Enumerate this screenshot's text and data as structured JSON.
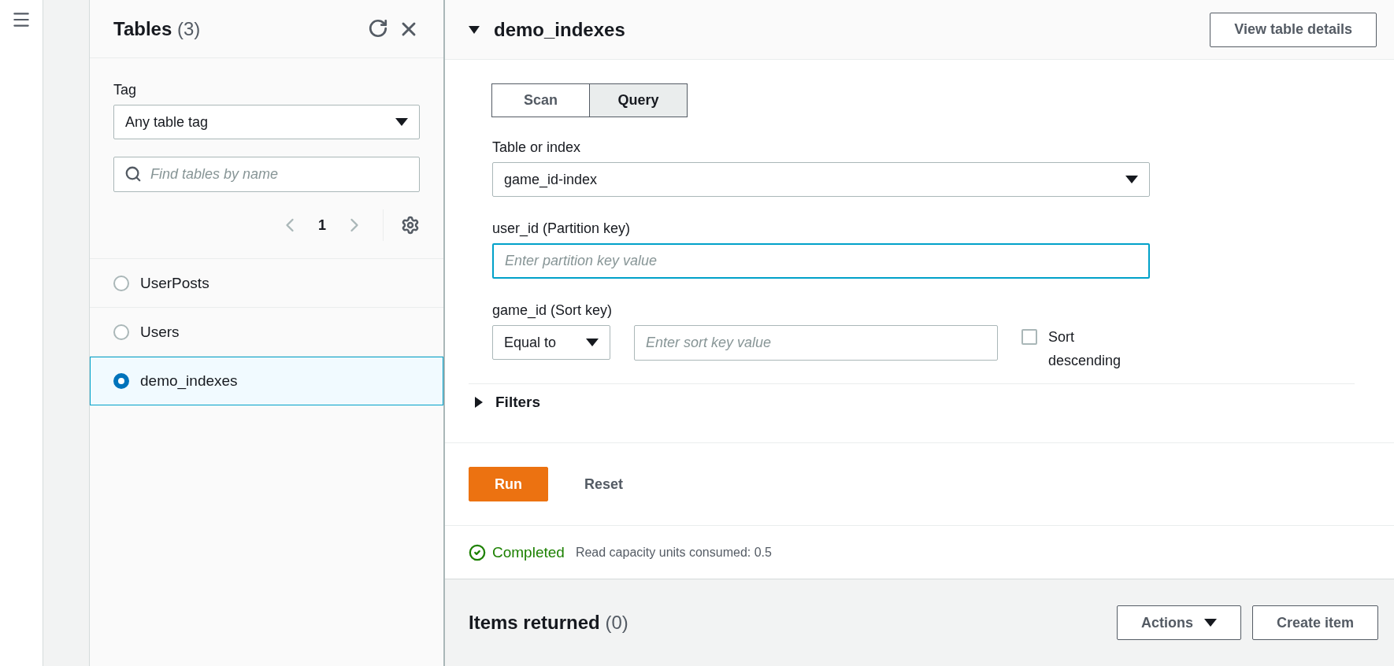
{
  "side_panel": {
    "title": "Tables",
    "count": "(3)",
    "tag_label": "Tag",
    "tag_value": "Any table tag",
    "search_placeholder": "Find tables by name",
    "page": "1",
    "tables": [
      {
        "name": "UserPosts",
        "selected": false
      },
      {
        "name": "Users",
        "selected": false
      },
      {
        "name": "demo_indexes",
        "selected": true
      }
    ]
  },
  "main": {
    "title": "demo_indexes",
    "expanded": true,
    "details_button": "View table details",
    "modes": [
      {
        "label": "Scan",
        "selected": false
      },
      {
        "label": "Query",
        "selected": true
      }
    ],
    "table_label": "Table or index",
    "table_value": "game_id-index",
    "partition_label": "user_id (Partition key)",
    "partition_placeholder": "Enter partition key value",
    "sort_label": "game_id (Sort key)",
    "sort_operator": "Equal to",
    "sort_placeholder": "Enter sort key value",
    "sort_descending": {
      "label": "Sort descending",
      "checked": false
    },
    "filters": {
      "label": "Filters",
      "expanded": false
    },
    "run_button": "Run",
    "reset_button": "Reset",
    "status": "Completed",
    "status_detail": "Read capacity units consumed: 0.5",
    "items_title": "Items returned",
    "items_count": "(0)",
    "actions_button": "Actions",
    "create_button": "Create item"
  }
}
